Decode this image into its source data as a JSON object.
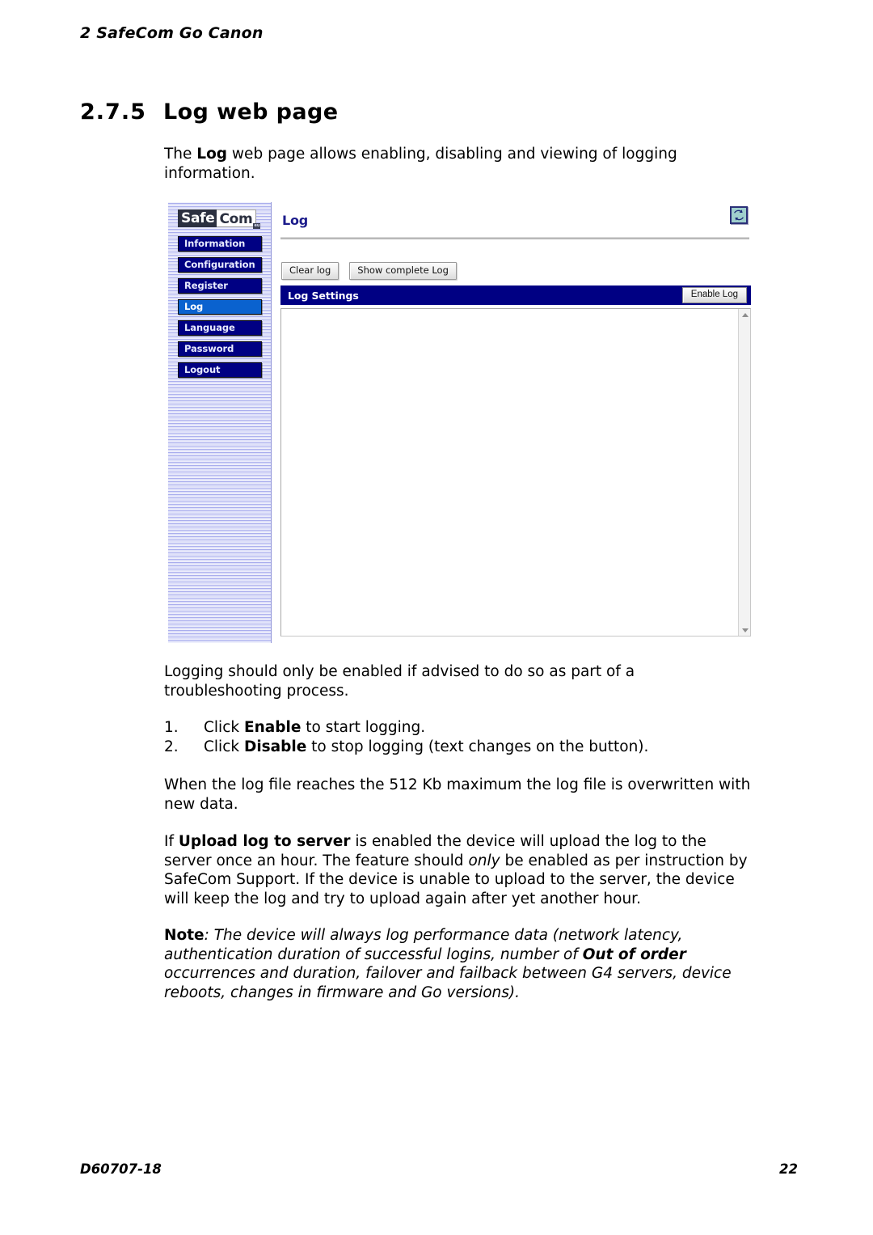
{
  "document": {
    "running_header": "2 SafeCom Go Canon",
    "section_number": "2.7.5",
    "section_title": "Log web page",
    "footer_left": "D60707-18",
    "footer_right": "22"
  },
  "paragraphs": {
    "intro_1": "The ",
    "intro_bold": "Log",
    "intro_2": " web page allows enabling, disabling and viewing of logging information.",
    "after_screenshot": "Logging should only be enabled if advised to do so as part of a troubleshooting process.",
    "max_size": "When the log file reaches the 512 Kb maximum the log file is overwritten with new data.",
    "upload_1": "If ",
    "upload_bold": "Upload log to server",
    "upload_2": " is enabled the device will upload the log to the server once an hour. The feature should ",
    "upload_italic": "only",
    "upload_3": " be enabled as per instruction by SafeCom Support. If the device is unable to upload to the server, the device will keep the log and try to upload again after yet another hour.",
    "note_label": "Note",
    "note_1": ": The device will always log performance data (network latency, authentication duration of successful logins, number of ",
    "note_bold": "Out of order",
    "note_2": " occurrences and duration, failover and failback between G4 servers, device reboots, changes in firmware and Go versions)."
  },
  "steps": [
    {
      "index": "1.",
      "pre": "Click ",
      "bold": "Enable",
      "post": " to start logging."
    },
    {
      "index": "2.",
      "pre": "Click ",
      "bold": "Disable",
      "post": " to stop logging (text changes on the button)."
    }
  ],
  "screenshot": {
    "logo": {
      "part1": "Safe",
      "part2": "Com",
      "badge": "eu"
    },
    "nav_items": [
      {
        "label": "Information",
        "active": false
      },
      {
        "label": "Configuration",
        "active": false
      },
      {
        "label": "Register",
        "active": false
      },
      {
        "label": "Log",
        "active": true
      },
      {
        "label": "Language",
        "active": false
      },
      {
        "label": "Password",
        "active": false
      },
      {
        "label": "Logout",
        "active": false
      }
    ],
    "page_title": "Log",
    "refresh_icon": "refresh-icon",
    "buttons": {
      "clear_log": "Clear log",
      "show_complete_log": "Show complete Log",
      "enable_log": "Enable Log"
    },
    "settings_bar_label": "Log Settings",
    "log_content": "",
    "colors": {
      "nav_inactive": "#000083",
      "nav_active": "#0a62cf",
      "title_blue": "#1d1d8c",
      "sidebar_bg": "#c3c6f4",
      "refresh_bg": "#9fcfcd"
    }
  }
}
